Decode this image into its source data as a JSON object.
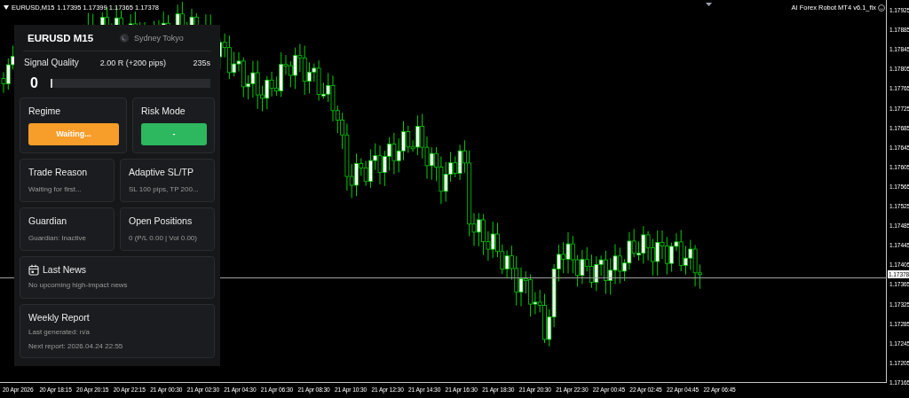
{
  "chart": {
    "symbol": "EURUSD,M15",
    "quotes": "1.17395 1.17399 1.17365 1.17378",
    "robot_label": "AI Forex Robot MT4 v6.1_fix",
    "current_price": "1.17378",
    "price_ticks": [
      "1.17925",
      "1.17885",
      "1.17845",
      "1.17805",
      "1.17765",
      "1.17725",
      "1.17685",
      "1.17645",
      "1.17605",
      "1.17565",
      "1.17525",
      "1.17485",
      "1.17445",
      "1.17405",
      "1.17365",
      "1.17325",
      "1.17285",
      "1.17245",
      "1.17205",
      "1.17165"
    ],
    "time_ticks": [
      "20 Apr 2026",
      "20 Apr 18:15",
      "20 Apr 20:15",
      "20 Apr 22:15",
      "21 Apr 00:30",
      "21 Apr 02:30",
      "21 Apr 04:30",
      "21 Apr 06:30",
      "21 Apr 08:30",
      "21 Apr 10:30",
      "21 Apr 12:30",
      "21 Apr 14:30",
      "21 Apr 16:30",
      "21 Apr 18:30",
      "21 Apr 20:30",
      "21 Apr 22:30",
      "22 Apr 00:45",
      "22 Apr 02:45",
      "22 Apr 04:45",
      "22 Apr 06:45"
    ]
  },
  "panel": {
    "title": "EURUSD M15",
    "session": "Sydney Tokyo",
    "signal": {
      "label": "Signal Quality",
      "reward": "2.00 R (+200 pips)",
      "timer": "235s",
      "score": "0",
      "level": 0.01
    },
    "status_cards": [
      {
        "title": "Regime",
        "value": "Waiting...",
        "color": "#f79d2a"
      },
      {
        "title": "Risk Mode",
        "value": "-",
        "color": "#2db75f"
      }
    ],
    "info_cards": [
      {
        "title": "Trade Reason",
        "text": "Waiting for first..."
      },
      {
        "title": "Adaptive SL/TP",
        "text": "SL 100 pips, TP 200..."
      },
      {
        "title": "Guardian",
        "text": "Guardian: Inactive"
      },
      {
        "title": "Open Positions",
        "text": "0 (P/L 0.00 | Vol 0.00)"
      }
    ],
    "news": {
      "title": "Last News",
      "text": "No upcoming high-impact news"
    },
    "report": {
      "title": "Weekly Report",
      "lines": [
        "Last generated: n/a",
        "Next report: 2026.04.24 22:55"
      ]
    }
  }
}
